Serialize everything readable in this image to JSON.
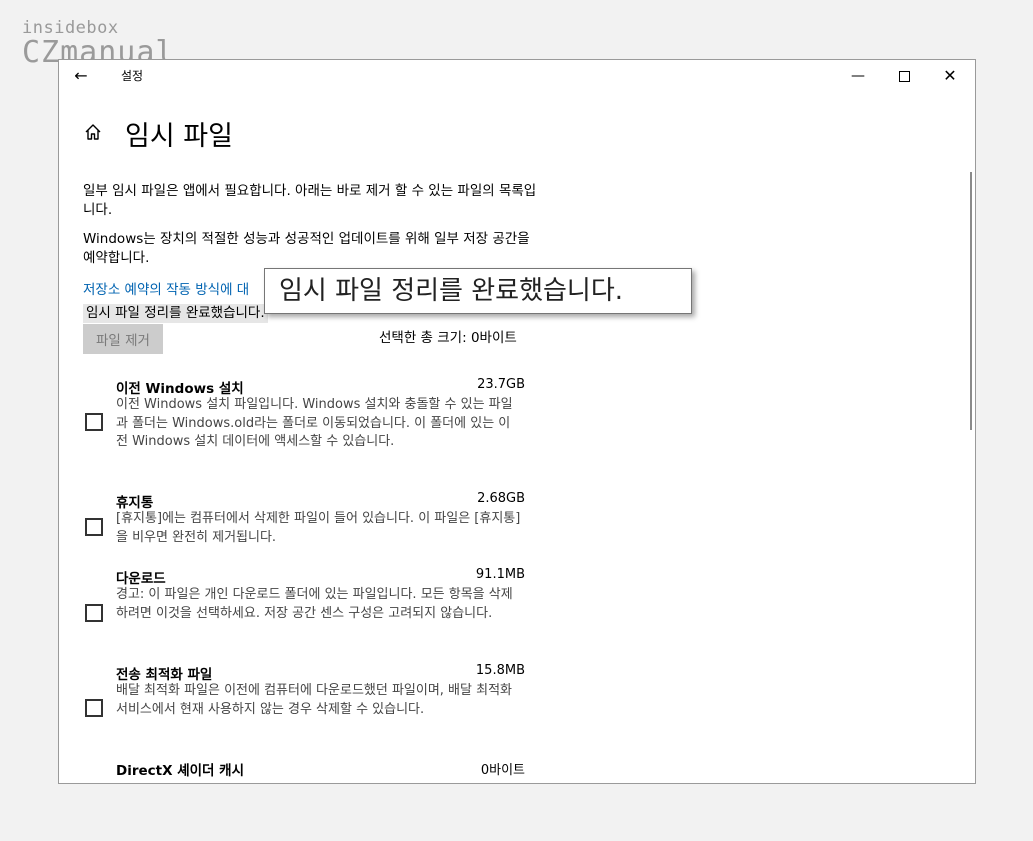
{
  "watermark": {
    "top": "insidebox",
    "main": "CZmanual"
  },
  "window": {
    "title": "설정",
    "back_icon": "←",
    "minimize_icon": "—",
    "close_icon": "✕"
  },
  "page": {
    "title": "임시 파일"
  },
  "content": {
    "p1": "일부 임시 파일은 앱에서 필요합니다. 아래는 바로 제거 할 수 있는 파일의 목록입니다.",
    "p2": "Windows는 장치의 적절한 성능과 성공적인 업데이트를 위해 일부 저장 공간을 예약합니다.",
    "link": "저장소 예약의 작동 방식에 대",
    "status_inline": "임시 파일 정리를 완료했습니다.",
    "remove_button": "파일 제거",
    "total_label": "선택한 총 크기: 0바이트"
  },
  "items": [
    {
      "name": "이전 Windows 설치",
      "size": "23.7GB",
      "desc": "이전 Windows 설치 파일입니다. Windows 설치와 충돌할 수 있는 파일과 폴더는 Windows.old라는 폴더로 이동되었습니다. 이 폴더에 있는 이전 Windows 설치 데이터에 액세스할 수 있습니다.",
      "checked": false
    },
    {
      "name": "휴지통",
      "size": "2.68GB",
      "desc": "[휴지통]에는 컴퓨터에서 삭제한 파일이 들어 있습니다. 이 파일은 [휴지통]을 비우면 완전히 제거됩니다.",
      "checked": false
    },
    {
      "name": "다운로드",
      "size": "91.1MB",
      "desc": "경고: 이 파일은 개인 다운로드 폴더에 있는 파일입니다. 모든 항목을 삭제하려면 이것을 선택하세요. 저장 공간 센스 구성은 고려되지 않습니다.",
      "checked": false
    },
    {
      "name": "전송 최적화 파일",
      "size": "15.8MB",
      "desc": "배달 최적화 파일은 이전에 컴퓨터에 다운로드했던 파일이며, 배달 최적화 서비스에서 현재 사용하지 않는 경우 삭제할 수 있습니다.",
      "checked": false
    },
    {
      "name": "DirectX 셰이더 캐시",
      "size": "0바이트",
      "desc": "",
      "checked": false
    }
  ],
  "toast": {
    "text": "임시 파일 정리를 완료했습니다."
  }
}
